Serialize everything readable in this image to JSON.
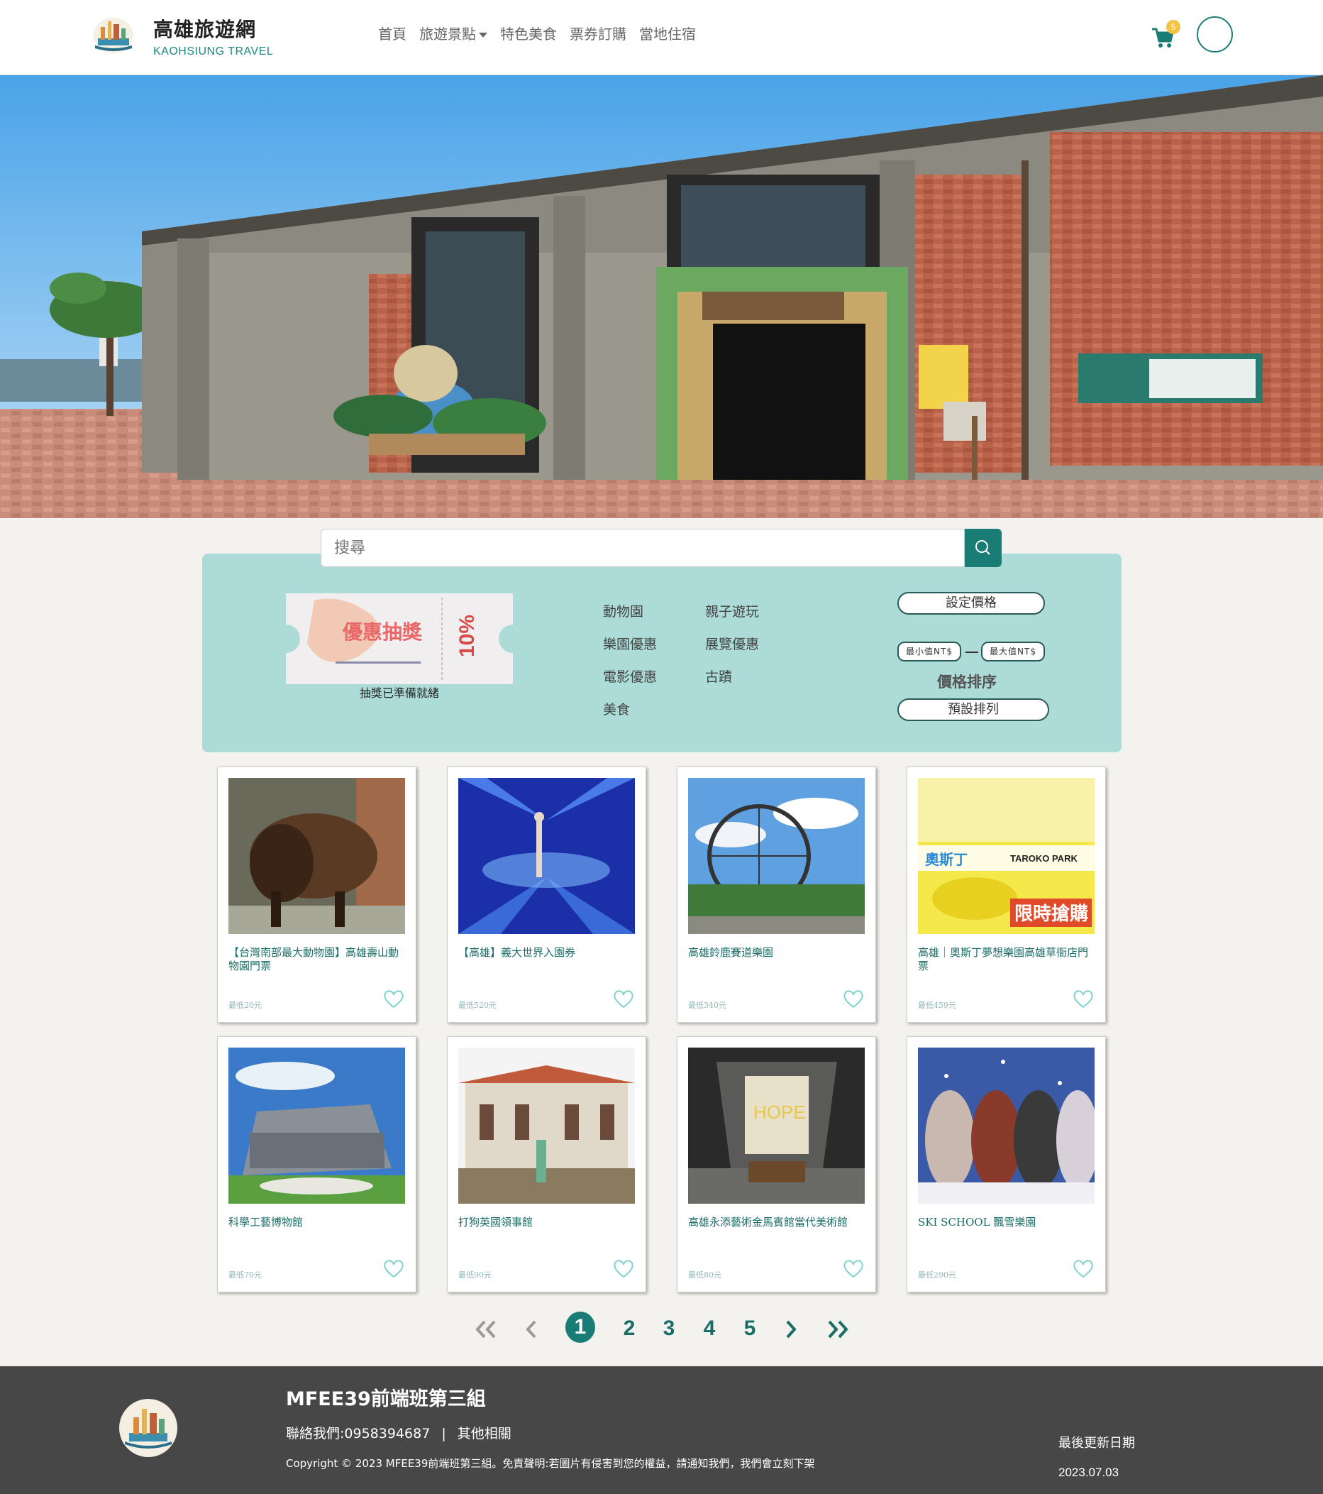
{
  "brand": {
    "title": "高雄旅遊網",
    "subtitle": "KAOHSIUNG TRAVEL"
  },
  "nav": {
    "items": [
      {
        "label": "首頁"
      },
      {
        "label": "旅遊景點",
        "dropdown": true
      },
      {
        "label": "特色美食"
      },
      {
        "label": "票券訂購"
      },
      {
        "label": "當地住宿"
      }
    ],
    "cart_count": "5",
    "cart_icon": "shopping-cart-icon"
  },
  "hero": {
    "slide_count": 8,
    "active_slide": 6
  },
  "search": {
    "placeholder": "搜尋",
    "value": "",
    "icon": "search-icon"
  },
  "filter": {
    "coupon": {
      "title": "優惠抽獎",
      "discount": "10%",
      "status": "抽獎已準備就緒"
    },
    "categories": [
      {
        "label": "動物園"
      },
      {
        "label": "親子遊玩"
      },
      {
        "label": "樂園優惠"
      },
      {
        "label": "展覽優惠"
      },
      {
        "label": "電影優惠"
      },
      {
        "label": "古蹟"
      },
      {
        "label": "美食"
      }
    ],
    "set_price_label": "設定價格",
    "min_placeholder": "最小值NT$",
    "max_placeholder": "最大值NT$",
    "sort_label": "價格排序",
    "sort_value": "預設排列"
  },
  "products": [
    {
      "title": "【台灣南部最大動物園】高雄壽山動物園門票",
      "price": "最低20元"
    },
    {
      "title": "【高雄】義大世界入園券",
      "price": "最低520元"
    },
    {
      "title": "高雄鈴鹿賽道樂園",
      "price": "最低340元"
    },
    {
      "title": "高雄｜奧斯丁夢想樂園高雄草衙店門票",
      "price": "最低459元"
    },
    {
      "title": "科學工藝博物館",
      "price": "最低70元"
    },
    {
      "title": "打狗英國領事館",
      "price": "最低90元"
    },
    {
      "title": "高雄永添藝術金馬賓館當代美術館",
      "price": "最低80元"
    },
    {
      "title": "SKI SCHOOL 飄雪樂園",
      "price": "最低290元"
    }
  ],
  "product_image_texts": {
    "p4_brand": "奧斯丁",
    "p4_brand2": "TAROKO PARK",
    "p4_promo": "限時搶購",
    "p7_sign": "HOPE"
  },
  "pagination": {
    "pages": [
      "1",
      "2",
      "3",
      "4",
      "5"
    ],
    "current": "1",
    "icons": [
      "double-chevron-left-icon",
      "chevron-left-icon",
      "chevron-right-icon",
      "double-chevron-right-icon"
    ]
  },
  "footer": {
    "team": "MFEE39前端班第三組",
    "contact": "聯絡我們:0958394687",
    "separator": "|",
    "other": "其他相關",
    "copyright": "Copyright © 2023 MFEE39前端班第三組。免責聲明:若圖片有侵害到您的權益，請通知我們，我們會立刻下架",
    "updated_label": "最後更新日期",
    "updated_date": "2023.07.03"
  },
  "colors": {
    "accent": "#1a7d75",
    "panel": "#addcd8",
    "footer": "#474747",
    "badge": "#f5c242",
    "heart": "#7fd3cc"
  }
}
